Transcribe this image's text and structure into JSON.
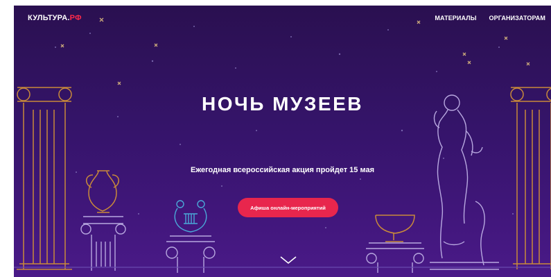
{
  "header": {
    "logo_main": "КУЛЬТУРА.",
    "logo_suffix": "РФ",
    "nav": [
      {
        "label": "МАТЕРИАЛЫ"
      },
      {
        "label": "ОРГАНИЗАТОРАМ"
      }
    ]
  },
  "hero": {
    "title": "НОЧЬ МУЗЕЕВ",
    "subtitle": "Ежегодная всероссийская акция пройдет 15 мая",
    "cta_label": "Афиша онлайн-мероприятий"
  },
  "colors": {
    "background_top": "#2a1050",
    "background_bottom": "#4a1a88",
    "accent": "#e8264d",
    "gold_line": "#c98a3a",
    "line_light": "#b8a8e0"
  },
  "icons": [
    "scroll-down-chevron-icon"
  ]
}
